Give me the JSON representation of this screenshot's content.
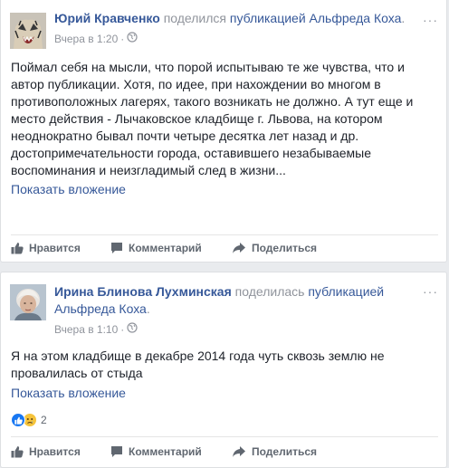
{
  "post1": {
    "author": "Юрий Кравченко",
    "action_text": "поделился",
    "shared_link": "публикацией Альфреда Коха",
    "period": ".",
    "timestamp": "Вчера в 1:20",
    "separator": "·",
    "audience_icon": "globe-icon",
    "more_label": "···",
    "text": "Поймал себя на мысли, что порой испытываю те же чувства, что и автор публикации. Хотя, по идее, при нахождении во многом в противоположных лагерях, такого возникать не должно. А тут еще и место действия - Лычаковское кладбище г. Львова, на котором неоднократно бывал почти четыре десятка лет назад и др. достопримечательности города, оставившего незабываемые воспоминания и неизгладимый след в жизни...",
    "attachment_link": "Показать вложение",
    "actions": {
      "like": "Нравится",
      "comment": "Комментарий",
      "share": "Поделиться"
    }
  },
  "post2": {
    "author": "Ирина Блинова Лухминская",
    "action_text": "поделилась",
    "shared_link_line1": "публикацией",
    "shared_link_line2": "Альфреда Коха",
    "period": ".",
    "timestamp": "Вчера в 1:10",
    "separator": "·",
    "audience_icon": "globe-icon",
    "more_label": "···",
    "text": "Я на этом кладбище в декабре 2014 года чуть сквозь землю не провалилась от стыда",
    "attachment_link": "Показать вложение",
    "reaction_count": "2",
    "actions": {
      "like": "Нравится",
      "comment": "Комментарий",
      "share": "Поделиться"
    }
  },
  "colors": {
    "link": "#365899",
    "meta": "#90949c",
    "action": "#606770",
    "like_blue": "#1877f2",
    "sad_yellow": "#f5c33b"
  }
}
